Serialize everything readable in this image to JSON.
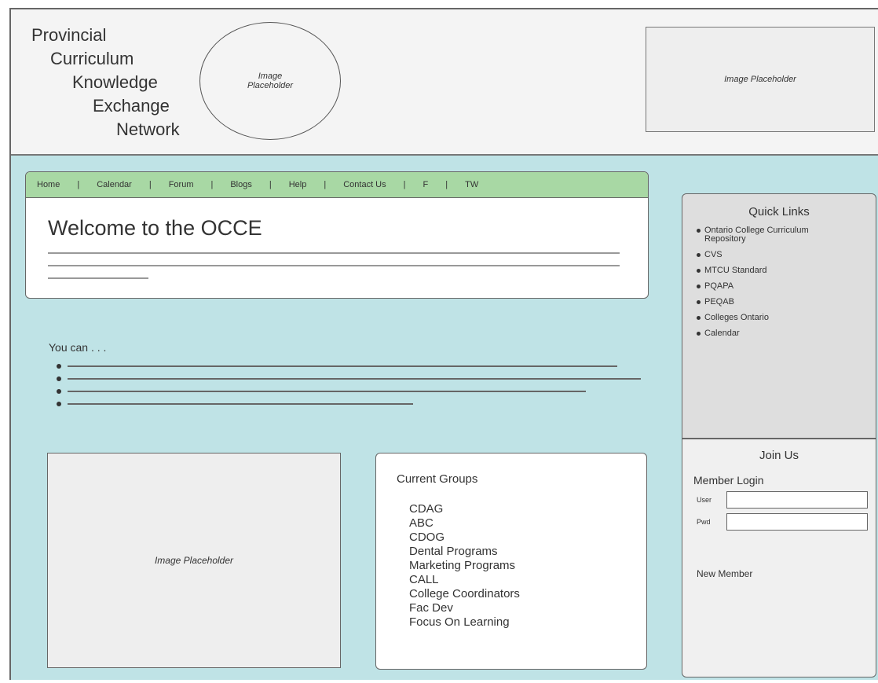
{
  "header": {
    "logo_lines": [
      "Provincial",
      "Curriculum",
      "Knowledge",
      "Exchange",
      "Network"
    ],
    "oval_placeholder": [
      "Image",
      "Placeholder"
    ],
    "right_placeholder": "Image Placeholder"
  },
  "nav": {
    "items": [
      "Home",
      "Calendar",
      "Forum",
      "Blogs",
      "Help",
      "Contact Us",
      "F",
      "TW"
    ],
    "separator": "|"
  },
  "welcome": {
    "title": "Welcome to the OCCE"
  },
  "you_can": {
    "label": "You can . . ."
  },
  "main_placeholder": "Image Placeholder",
  "groups": {
    "title": "Current Groups",
    "items": [
      "CDAG",
      "ABC",
      "CDOG",
      "Dental Programs",
      "Marketing Programs",
      "CALL",
      "College Coordinators",
      "Fac Dev",
      "Focus On Learning"
    ]
  },
  "quick_links": {
    "title": "Quick Links",
    "items": [
      "Ontario College Curriculum Repository",
      "CVS",
      "MTCU Standard",
      "PQAPA",
      "PEQAB",
      "Colleges Ontario",
      "Calendar"
    ]
  },
  "join": {
    "title": "Join Us",
    "member_login": "Member Login",
    "user_label": "User",
    "pwd_label": "Pwd",
    "new_member": "New Member"
  }
}
